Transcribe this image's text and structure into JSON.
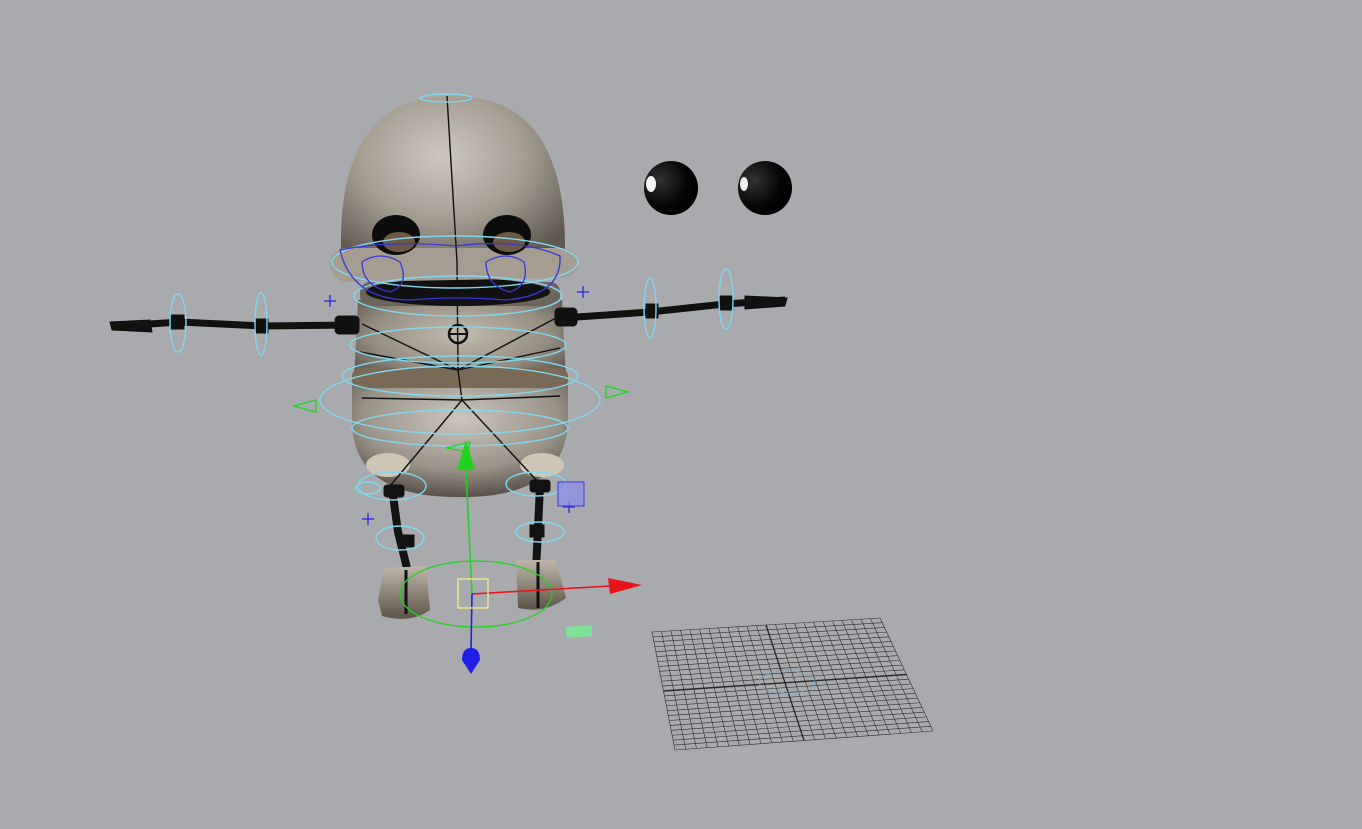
{
  "viewport": {
    "background": "#a9aaae",
    "description_label": ""
  },
  "colors": {
    "body_metal": "#9e968c",
    "body_dark": "#5f574d",
    "rig_cyan": "#7fd8f0",
    "rig_blue": "#3a36d8",
    "axis_x": "#e8141a",
    "axis_y": "#1fd31f",
    "axis_z": "#1e1ee6",
    "pivot_yellow": "#f2e88a",
    "grid_line": "#2a2a2a"
  },
  "icons": {
    "move_manipulator": "move-manipulator-icon",
    "cross_locator": "cross-locator-icon",
    "arrow_x": "arrow-x-icon",
    "arrow_y": "arrow-y-icon",
    "arrow_z": "arrow-z-icon"
  }
}
